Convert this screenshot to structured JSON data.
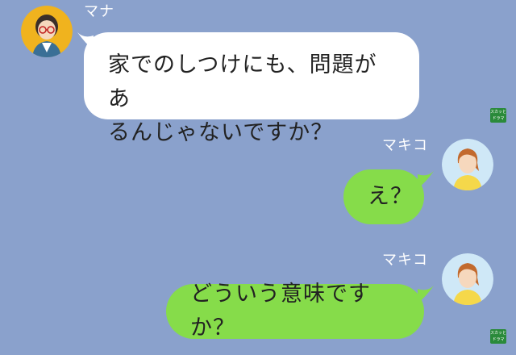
{
  "messages": [
    {
      "sender": "マナ",
      "side": "left",
      "text_line1": "家でのしつけにも、問題があ",
      "text_line2": "るんじゃないですか？"
    },
    {
      "sender": "マキコ",
      "side": "right",
      "text": "え？"
    },
    {
      "sender": "マキコ",
      "side": "right",
      "text": "どういう意味ですか？"
    }
  ],
  "watermark": {
    "line1": "スカッと",
    "line2": "ドラマ"
  },
  "colors": {
    "background": "#8aa1cc",
    "incoming_bubble": "#ffffff",
    "outgoing_bubble": "#86dc4a",
    "name_text": "#ffffff"
  },
  "icons": [
    "avatar-mana",
    "avatar-makiko",
    "watermark-logo"
  ]
}
